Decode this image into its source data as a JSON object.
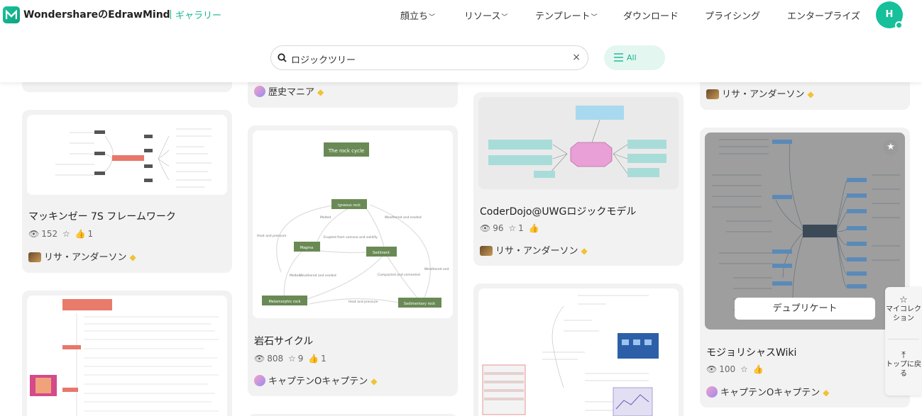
{
  "header": {
    "brand": "WondershareのEdrawMind",
    "gallery": "ギャラリー",
    "nav": [
      {
        "label": "顔立ち",
        "dropdown": true
      },
      {
        "label": "リソース",
        "dropdown": true
      },
      {
        "label": "テンプレート",
        "dropdown": true
      },
      {
        "label": "ダウンロード",
        "dropdown": false
      },
      {
        "label": "プライシング",
        "dropdown": false
      },
      {
        "label": "エンタープライズ",
        "dropdown": false
      }
    ],
    "avatar_initial": "H"
  },
  "search": {
    "value": "ロジックツリー",
    "clear": "×",
    "filter_label": "All"
  },
  "cards": {
    "c1": {
      "author": "歴史マニア"
    },
    "c2": {
      "author": "リサ・アンダーソン"
    },
    "c3": {
      "title": "マッキンゼー 7S フレームワーク",
      "views": "152",
      "likes": "1",
      "author": "リサ・アンダーソン"
    },
    "c4": {
      "title": "岩石サイクル",
      "views": "808",
      "stars": "9",
      "likes": "1",
      "author": "キャプテンOキャプテン"
    },
    "c5": {
      "title": "CoderDojo@UWGロジックモデル",
      "views": "96",
      "stars": "1",
      "author": "リサ・アンダーソン"
    },
    "c6": {
      "title": "モジョリシャスWiki",
      "views": "100",
      "author": "キャプテンOキャプテン",
      "duplicate": "デュプリケート"
    }
  },
  "rock_cycle": {
    "title": "The rock cycle",
    "nodes": [
      "Igneous rock",
      "Magma",
      "Sediment",
      "Metamorphic rock",
      "Sedimentary rock"
    ],
    "edges": [
      "Melted",
      "Weathered and eroded",
      "Heat and pressure",
      "Erupted from volcano and solidify",
      "Compacted and cemented",
      "Melted",
      "Weathered and eroded",
      "Heat and pressure",
      "Weathered and"
    ]
  },
  "side_panel": {
    "collection": "マイコレクション",
    "top": "トップに戻る"
  },
  "colors": {
    "accent": "#19b58f",
    "card_bg": "#f2f2f2",
    "node": "#6a8a55"
  }
}
